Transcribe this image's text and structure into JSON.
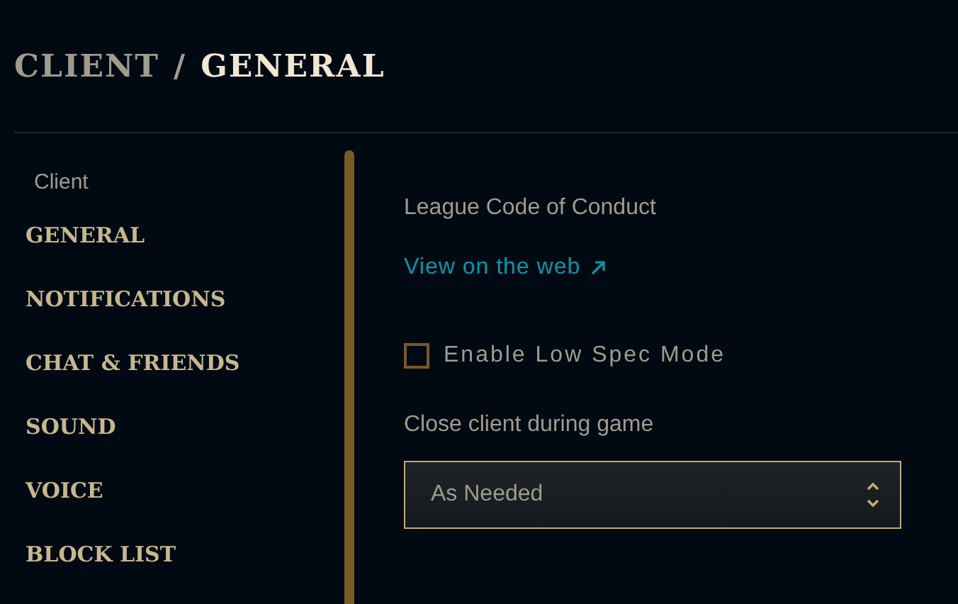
{
  "header": {
    "parent": "CLIENT",
    "separator": "/",
    "current": "GENERAL"
  },
  "sidebar": {
    "section": "Client",
    "items": [
      {
        "label": "GENERAL"
      },
      {
        "label": "NOTIFICATIONS"
      },
      {
        "label": "CHAT & FRIENDS"
      },
      {
        "label": "SOUND"
      },
      {
        "label": "VOICE"
      },
      {
        "label": "BLOCK LIST"
      }
    ]
  },
  "content": {
    "heading": "League Code of Conduct",
    "link": "View on the web",
    "low_spec": {
      "label": "Enable Low Spec Mode",
      "checked": false
    },
    "close_client": {
      "label": "Close client during game",
      "value": "As Needed"
    }
  }
}
